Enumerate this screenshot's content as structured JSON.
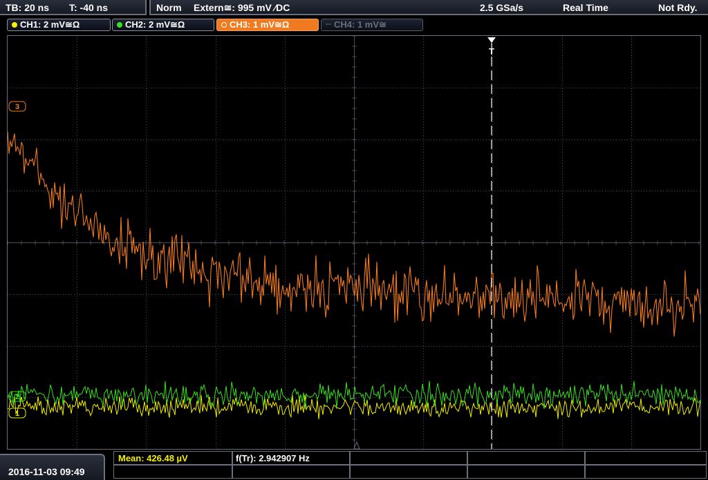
{
  "timebase": {
    "tb": "TB: 20 ns",
    "trig_pos": "T: -40 ns"
  },
  "status": {
    "mode": "Norm",
    "trigger": "Extern≅: 995 mV ∕DC",
    "sample_rate": "2.5 GSa/s",
    "acq": "Real Time",
    "ready": "Not Rdy."
  },
  "channels": [
    {
      "label": "CH1: 2 mV≅Ω",
      "color": "#f3f000",
      "state": "on"
    },
    {
      "label": "CH2: 2 mV≅Ω",
      "color": "#39e020",
      "state": "on"
    },
    {
      "label": "CH3: 1 mV≅Ω",
      "color": "#f07a20",
      "state": "active"
    },
    {
      "label": "CH4: 1 mV≅",
      "color": "#6a6f7c",
      "state": "off"
    }
  ],
  "markers": {
    "ch3": "3",
    "ch2": "2",
    "ch1": "1",
    "trigger": "T"
  },
  "datetime": "2016-11-03 09:49",
  "measurements": {
    "mean": "Mean: 426.48 µV",
    "freq": "f(Tr): 2.942907 Hz"
  },
  "colors": {
    "ch1": "#f3f000",
    "ch2": "#39e020",
    "ch3": "#f07a20",
    "grid": "#4a4f5a"
  }
}
